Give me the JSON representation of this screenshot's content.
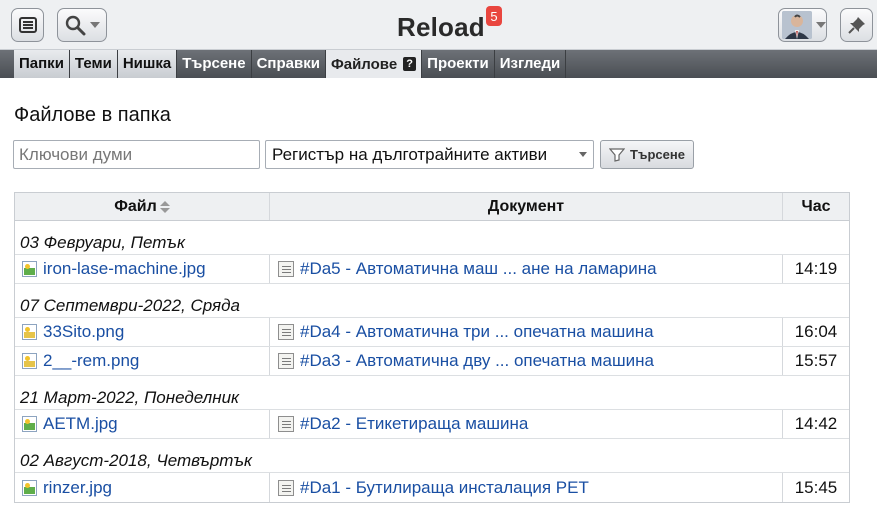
{
  "header": {
    "app_title": "Reload",
    "notification_count": "5"
  },
  "nav": {
    "tabs": [
      {
        "label": "Папки"
      },
      {
        "label": "Теми"
      },
      {
        "label": "Нишка"
      },
      {
        "label": "Търсене"
      },
      {
        "label": "Справки"
      },
      {
        "label": "Файлове",
        "help": "?"
      },
      {
        "label": "Проекти"
      },
      {
        "label": "Изгледи"
      }
    ],
    "active_tab": "Файлове"
  },
  "main": {
    "heading": "Файлове в папка",
    "keywords_placeholder": "Ключови думи",
    "register_value": "Регистър на дълготрайните активи",
    "search_label": "Търсене"
  },
  "table": {
    "columns": {
      "file": "Файл",
      "document": "Документ",
      "time": "Час"
    },
    "groups": [
      {
        "date": "03 Февруари, Петък",
        "rows": [
          {
            "file": "iron-lase-machine.jpg",
            "file_type": "image-jpg-icon",
            "document": "#Da5 - Автоматична маш ... ане на ламарина",
            "time": "14:19"
          }
        ]
      },
      {
        "date": "07 Септември-2022, Сряда",
        "rows": [
          {
            "file": "33Sito.png",
            "file_type": "image-png-icon",
            "document": "#Da4 - Автоматична три ... опечатна машина",
            "time": "16:04"
          },
          {
            "file": "2__-rem.png",
            "file_type": "image-png-icon",
            "document": "#Da3 - Автоматична дву ... опечатна машина",
            "time": "15:57"
          }
        ]
      },
      {
        "date": "21 Март-2022, Понеделник",
        "rows": [
          {
            "file": "AETM.jpg",
            "file_type": "image-jpg-icon",
            "document": "#Da2 - Етикетираща машина",
            "time": "14:42"
          }
        ]
      },
      {
        "date": "02 Август-2018, Четвъртък",
        "rows": [
          {
            "file": "rinzer.jpg",
            "file_type": "image-jpg-icon",
            "document": "#Da1 - Бутилираща инсталация PET",
            "time": "15:45"
          }
        ]
      }
    ]
  },
  "colors": {
    "link": "#1a4fa3",
    "badge": "#e9463f",
    "nav_background": "#5a5e63"
  }
}
